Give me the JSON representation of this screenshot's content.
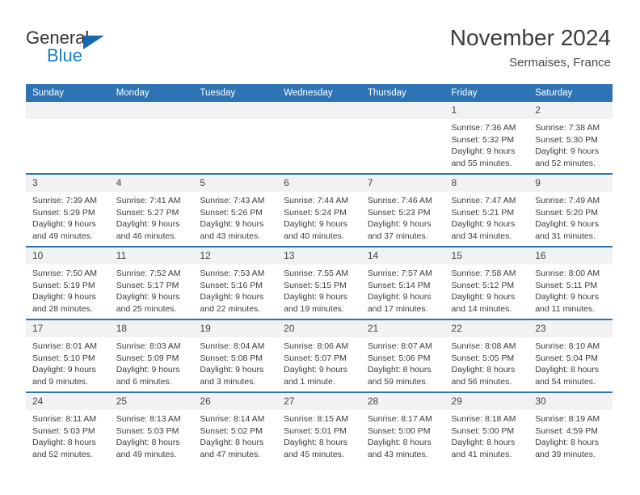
{
  "logo": {
    "word1": "General",
    "word2": "Blue",
    "triangle_color": "#1668b0",
    "word2_color": "#1a7fc1"
  },
  "header": {
    "title": "November 2024",
    "subtitle": "Sermaises, France",
    "header_bg_color": "#2e74b5"
  },
  "calendar": {
    "weekday_headers": [
      "Sunday",
      "Monday",
      "Tuesday",
      "Wednesday",
      "Thursday",
      "Friday",
      "Saturday"
    ],
    "weeks": [
      [
        {
          "day": "",
          "empty": true
        },
        {
          "day": "",
          "empty": true
        },
        {
          "day": "",
          "empty": true
        },
        {
          "day": "",
          "empty": true
        },
        {
          "day": "",
          "empty": true
        },
        {
          "day": "1",
          "sunrise": "Sunrise: 7:36 AM",
          "sunset": "Sunset: 5:32 PM",
          "daylight1": "Daylight: 9 hours",
          "daylight2": "and 55 minutes."
        },
        {
          "day": "2",
          "sunrise": "Sunrise: 7:38 AM",
          "sunset": "Sunset: 5:30 PM",
          "daylight1": "Daylight: 9 hours",
          "daylight2": "and 52 minutes."
        }
      ],
      [
        {
          "day": "3",
          "sunrise": "Sunrise: 7:39 AM",
          "sunset": "Sunset: 5:29 PM",
          "daylight1": "Daylight: 9 hours",
          "daylight2": "and 49 minutes."
        },
        {
          "day": "4",
          "sunrise": "Sunrise: 7:41 AM",
          "sunset": "Sunset: 5:27 PM",
          "daylight1": "Daylight: 9 hours",
          "daylight2": "and 46 minutes."
        },
        {
          "day": "5",
          "sunrise": "Sunrise: 7:43 AM",
          "sunset": "Sunset: 5:26 PM",
          "daylight1": "Daylight: 9 hours",
          "daylight2": "and 43 minutes."
        },
        {
          "day": "6",
          "sunrise": "Sunrise: 7:44 AM",
          "sunset": "Sunset: 5:24 PM",
          "daylight1": "Daylight: 9 hours",
          "daylight2": "and 40 minutes."
        },
        {
          "day": "7",
          "sunrise": "Sunrise: 7:46 AM",
          "sunset": "Sunset: 5:23 PM",
          "daylight1": "Daylight: 9 hours",
          "daylight2": "and 37 minutes."
        },
        {
          "day": "8",
          "sunrise": "Sunrise: 7:47 AM",
          "sunset": "Sunset: 5:21 PM",
          "daylight1": "Daylight: 9 hours",
          "daylight2": "and 34 minutes."
        },
        {
          "day": "9",
          "sunrise": "Sunrise: 7:49 AM",
          "sunset": "Sunset: 5:20 PM",
          "daylight1": "Daylight: 9 hours",
          "daylight2": "and 31 minutes."
        }
      ],
      [
        {
          "day": "10",
          "sunrise": "Sunrise: 7:50 AM",
          "sunset": "Sunset: 5:19 PM",
          "daylight1": "Daylight: 9 hours",
          "daylight2": "and 28 minutes."
        },
        {
          "day": "11",
          "sunrise": "Sunrise: 7:52 AM",
          "sunset": "Sunset: 5:17 PM",
          "daylight1": "Daylight: 9 hours",
          "daylight2": "and 25 minutes."
        },
        {
          "day": "12",
          "sunrise": "Sunrise: 7:53 AM",
          "sunset": "Sunset: 5:16 PM",
          "daylight1": "Daylight: 9 hours",
          "daylight2": "and 22 minutes."
        },
        {
          "day": "13",
          "sunrise": "Sunrise: 7:55 AM",
          "sunset": "Sunset: 5:15 PM",
          "daylight1": "Daylight: 9 hours",
          "daylight2": "and 19 minutes."
        },
        {
          "day": "14",
          "sunrise": "Sunrise: 7:57 AM",
          "sunset": "Sunset: 5:14 PM",
          "daylight1": "Daylight: 9 hours",
          "daylight2": "and 17 minutes."
        },
        {
          "day": "15",
          "sunrise": "Sunrise: 7:58 AM",
          "sunset": "Sunset: 5:12 PM",
          "daylight1": "Daylight: 9 hours",
          "daylight2": "and 14 minutes."
        },
        {
          "day": "16",
          "sunrise": "Sunrise: 8:00 AM",
          "sunset": "Sunset: 5:11 PM",
          "daylight1": "Daylight: 9 hours",
          "daylight2": "and 11 minutes."
        }
      ],
      [
        {
          "day": "17",
          "sunrise": "Sunrise: 8:01 AM",
          "sunset": "Sunset: 5:10 PM",
          "daylight1": "Daylight: 9 hours",
          "daylight2": "and 9 minutes."
        },
        {
          "day": "18",
          "sunrise": "Sunrise: 8:03 AM",
          "sunset": "Sunset: 5:09 PM",
          "daylight1": "Daylight: 9 hours",
          "daylight2": "and 6 minutes."
        },
        {
          "day": "19",
          "sunrise": "Sunrise: 8:04 AM",
          "sunset": "Sunset: 5:08 PM",
          "daylight1": "Daylight: 9 hours",
          "daylight2": "and 3 minutes."
        },
        {
          "day": "20",
          "sunrise": "Sunrise: 8:06 AM",
          "sunset": "Sunset: 5:07 PM",
          "daylight1": "Daylight: 9 hours",
          "daylight2": "and 1 minute."
        },
        {
          "day": "21",
          "sunrise": "Sunrise: 8:07 AM",
          "sunset": "Sunset: 5:06 PM",
          "daylight1": "Daylight: 8 hours",
          "daylight2": "and 59 minutes."
        },
        {
          "day": "22",
          "sunrise": "Sunrise: 8:08 AM",
          "sunset": "Sunset: 5:05 PM",
          "daylight1": "Daylight: 8 hours",
          "daylight2": "and 56 minutes."
        },
        {
          "day": "23",
          "sunrise": "Sunrise: 8:10 AM",
          "sunset": "Sunset: 5:04 PM",
          "daylight1": "Daylight: 8 hours",
          "daylight2": "and 54 minutes."
        }
      ],
      [
        {
          "day": "24",
          "sunrise": "Sunrise: 8:11 AM",
          "sunset": "Sunset: 5:03 PM",
          "daylight1": "Daylight: 8 hours",
          "daylight2": "and 52 minutes."
        },
        {
          "day": "25",
          "sunrise": "Sunrise: 8:13 AM",
          "sunset": "Sunset: 5:03 PM",
          "daylight1": "Daylight: 8 hours",
          "daylight2": "and 49 minutes."
        },
        {
          "day": "26",
          "sunrise": "Sunrise: 8:14 AM",
          "sunset": "Sunset: 5:02 PM",
          "daylight1": "Daylight: 8 hours",
          "daylight2": "and 47 minutes."
        },
        {
          "day": "27",
          "sunrise": "Sunrise: 8:15 AM",
          "sunset": "Sunset: 5:01 PM",
          "daylight1": "Daylight: 8 hours",
          "daylight2": "and 45 minutes."
        },
        {
          "day": "28",
          "sunrise": "Sunrise: 8:17 AM",
          "sunset": "Sunset: 5:00 PM",
          "daylight1": "Daylight: 8 hours",
          "daylight2": "and 43 minutes."
        },
        {
          "day": "29",
          "sunrise": "Sunrise: 8:18 AM",
          "sunset": "Sunset: 5:00 PM",
          "daylight1": "Daylight: 8 hours",
          "daylight2": "and 41 minutes."
        },
        {
          "day": "30",
          "sunrise": "Sunrise: 8:19 AM",
          "sunset": "Sunset: 4:59 PM",
          "daylight1": "Daylight: 8 hours",
          "daylight2": "and 39 minutes."
        }
      ]
    ]
  }
}
